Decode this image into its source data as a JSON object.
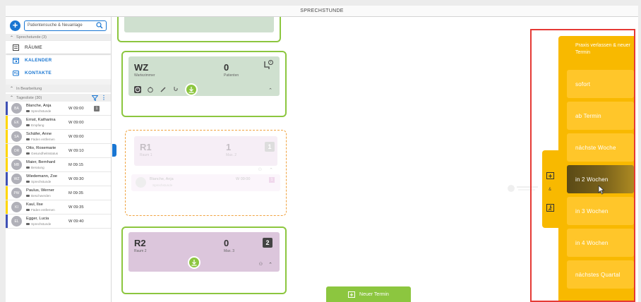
{
  "window": {
    "title": "SPRECHSTUNDE"
  },
  "sidebar": {
    "search_placeholder": "Patientensuche & Neuanlage",
    "section_header": "Sprechstunde (3)",
    "nav": [
      {
        "label": "RÄUME",
        "icon": "rooms-icon"
      },
      {
        "label": "KALENDER",
        "icon": "calendar-icon"
      },
      {
        "label": "KONTAKTE",
        "icon": "contacts-icon"
      }
    ],
    "in_progress_header": "In Bearbeitung",
    "list_header": "Tagesliste (30)",
    "patients": [
      {
        "initials": "BA",
        "name": "Blanche, Anja",
        "sub": "Sprechstunde",
        "time": "W 09:00",
        "badge": "1",
        "color": "#3f51b5"
      },
      {
        "initials": "EK",
        "name": "Ernst, Katharina",
        "sub": "Empfang",
        "time": "W 09:00",
        "badge": "",
        "color": "#ffd600"
      },
      {
        "initials": "SA",
        "name": "Schäfer, Anne",
        "sub": "Fäden entfernen",
        "time": "W 09:00",
        "badge": "",
        "color": "#ffd600"
      },
      {
        "initials": "OR",
        "name": "Otto, Rosemarie",
        "sub": "Gesundheitsstatus",
        "time": "W 09:10",
        "badge": "",
        "color": "#ffd600"
      },
      {
        "initials": "MB",
        "name": "Maier, Bernhard",
        "sub": "Beratung",
        "time": "M 09:15",
        "badge": "",
        "color": "#ffd600"
      },
      {
        "initials": "WZ",
        "name": "Wiedemann, Zoe",
        "sub": "Sprechstunde",
        "time": "W 09:30",
        "badge": "",
        "color": "#3f51b5"
      },
      {
        "initials": "PW",
        "name": "Paulus, Werner",
        "sub": "Beschwerden",
        "time": "M 09:35",
        "badge": "",
        "color": "#ffd600"
      },
      {
        "initials": "KI",
        "name": "Kaul, Ilse",
        "sub": "Fäden entfernen",
        "time": "W 09:35",
        "badge": "",
        "color": "#ffd600"
      },
      {
        "initials": "EL",
        "name": "Egger, Lucia",
        "sub": "Sprechstunde",
        "time": "W 09:40",
        "badge": "",
        "color": "#3f51b5"
      }
    ]
  },
  "rooms": {
    "wz": {
      "title": "WZ",
      "sub": "Wartezimmer",
      "count": "0",
      "count_label": "Patienten"
    },
    "r1": {
      "title": "R1",
      "sub": "Raum 1",
      "count": "1",
      "count_label": "Max. 2",
      "number": "1",
      "ghost_name": "Blanche, Anja",
      "ghost_sub": "Sprechstunde",
      "ghost_time": "W 09:00",
      "ghost_badge": "1"
    },
    "r2": {
      "title": "R2",
      "sub": "Raum 2",
      "count": "0",
      "count_label": "Max. 3",
      "number": "2"
    }
  },
  "new_appointment": {
    "label": "Neuer Termin"
  },
  "options": {
    "title": "Praxis verlassen & neuer Termin",
    "items": [
      "sofort",
      "ab Termin",
      "nächste Woche",
      "in 2 Wochen",
      "in 3 Wochen",
      "in 4 Wochen",
      "nächstes Quartal"
    ],
    "hovered": "in 2 Wochen",
    "side_tab_amp": "&"
  },
  "colors": {
    "accent": "#1976d2",
    "green": "#8cc63f",
    "amber": "#f8b900",
    "red_frame": "#e53935"
  }
}
